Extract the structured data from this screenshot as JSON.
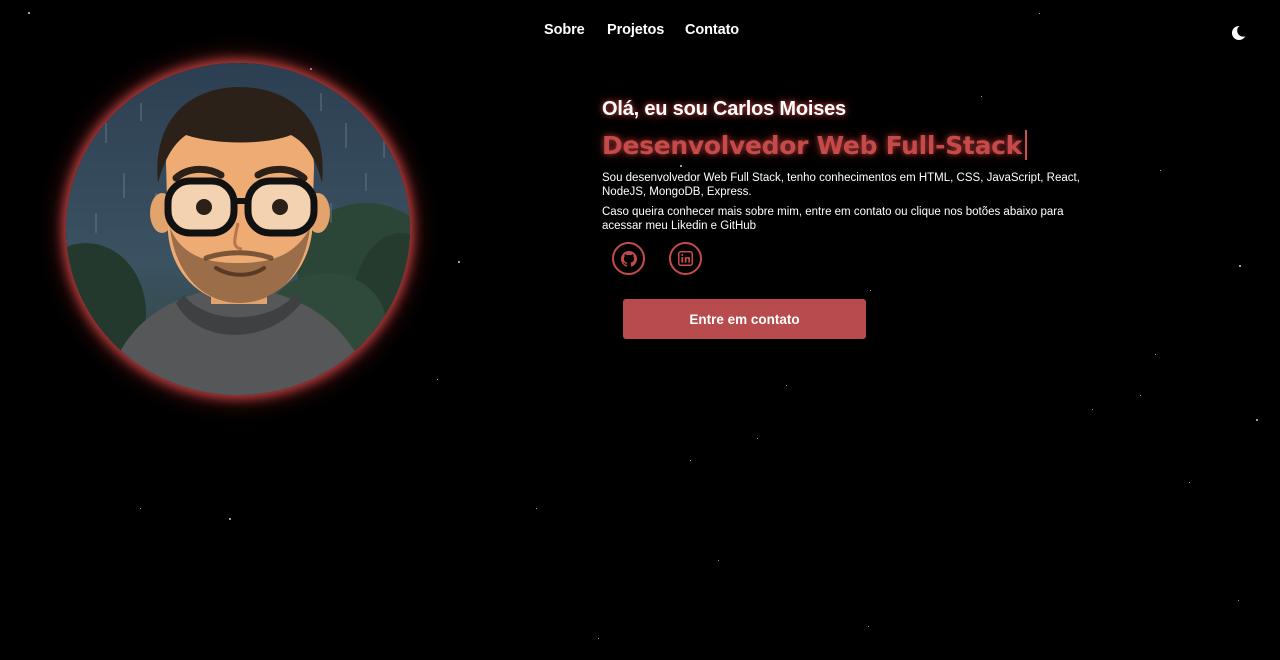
{
  "nav": {
    "links": [
      {
        "label": "Sobre"
      },
      {
        "label": "Projetos"
      },
      {
        "label": "Contato"
      }
    ],
    "theme_toggle_icon": "moon-icon"
  },
  "hero": {
    "greeting": "Olá, eu sou Carlos Moises",
    "role": "Desenvolvedor Web Full-Stack",
    "bio_1": "Sou desenvolvedor Web Full Stack, tenho conhecimentos em HTML, CSS, JavaScript, React, NodeJS, MongoDB, Express.",
    "bio_2": "Caso queira conhecer mais sobre mim, entre em contato ou clique nos botões abaixo para acessar meu Likedin e GitHub",
    "social": [
      {
        "icon": "github-icon"
      },
      {
        "icon": "linkedin-icon"
      }
    ],
    "cta_label": "Entre em contato",
    "avatar_icon": "avatar-illustration"
  },
  "colors": {
    "background": "#000000",
    "accent": "#c54b4b",
    "button": "#b84b4d",
    "text": "#ffffff"
  }
}
